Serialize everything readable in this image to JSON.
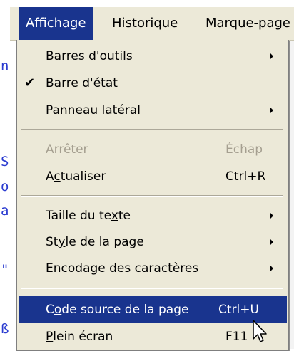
{
  "background": {
    "left_glyphs": [
      "n",
      "S",
      "o",
      "a",
      "\"",
      "ß"
    ]
  },
  "menubar": {
    "items": [
      {
        "label": "Affichage",
        "active": true
      },
      {
        "label": "Historique",
        "active": false
      },
      {
        "label": "Marque-page",
        "active": false
      }
    ]
  },
  "menu": {
    "items": [
      {
        "type": "item",
        "pre": "Barres d'ou",
        "acc": "t",
        "post": "ils",
        "submenu": true
      },
      {
        "type": "item",
        "pre": "",
        "acc": "B",
        "post": "arre d'état",
        "checked": true
      },
      {
        "type": "item",
        "pre": "Pann",
        "acc": "e",
        "post": "au latéral",
        "submenu": true
      },
      {
        "type": "separator"
      },
      {
        "type": "item",
        "pre": "Arr",
        "acc": "ê",
        "post": "ter",
        "shortcut": "Échap",
        "disabled": true
      },
      {
        "type": "item",
        "pre": "A",
        "acc": "c",
        "post": "tualiser",
        "shortcut": "Ctrl+R"
      },
      {
        "type": "separator"
      },
      {
        "type": "item",
        "pre": "Taille du te",
        "acc": "x",
        "post": "te",
        "submenu": true
      },
      {
        "type": "item",
        "pre": "St",
        "acc": "y",
        "post": "le de la page",
        "submenu": true
      },
      {
        "type": "item",
        "pre": "E",
        "acc": "n",
        "post": "codage des caractères",
        "submenu": true
      },
      {
        "type": "separator"
      },
      {
        "type": "item",
        "pre": "C",
        "acc": "o",
        "post": "de source de la page",
        "shortcut": "Ctrl+U",
        "highlighted": true
      },
      {
        "type": "item",
        "pre": "",
        "acc": "P",
        "post": "lein écran",
        "shortcut": "F11"
      }
    ]
  },
  "colors": {
    "menu_bg": "#ece9d8",
    "highlight": "#19348e",
    "disabled_text": "#a59f90",
    "background_glyph": "#2a3bd0"
  }
}
